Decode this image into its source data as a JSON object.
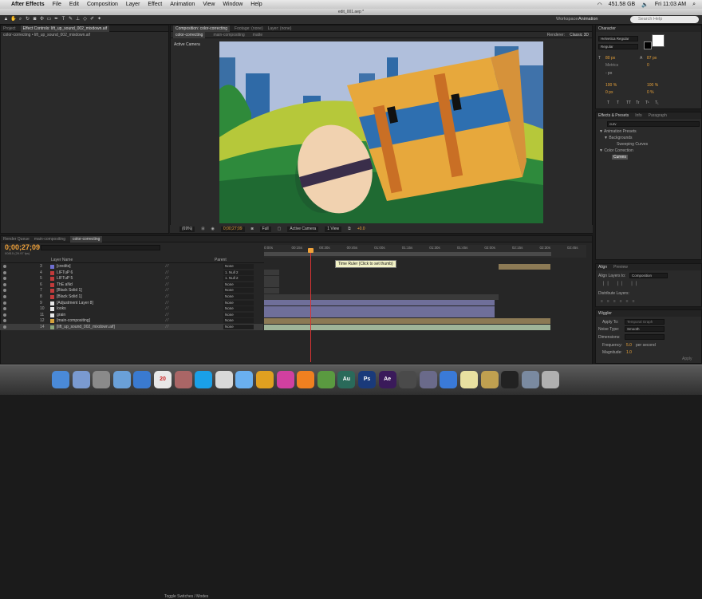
{
  "menubar": {
    "app_name": "After Effects",
    "items": [
      "File",
      "Edit",
      "Composition",
      "Layer",
      "Effect",
      "Animation",
      "View",
      "Window",
      "Help"
    ],
    "battery": "451.58 GB",
    "clock": "Fri 11:03 AM"
  },
  "window_title": "edit_001.aep *",
  "toolbar": {
    "workspace_label": "Workspace:",
    "workspace_value": "Animation",
    "search_placeholder": "Search Help"
  },
  "project_panel": {
    "tabs": [
      "Project",
      "Effect Controls: lift_up_sound_002_mixdown.aif"
    ],
    "subtitle": "color-correcting • lift_up_sound_002_mixdown.aif"
  },
  "comp_panel": {
    "tabs": [
      "Composition: color-correcting",
      "Footage: (none)",
      "Layer: (none)"
    ],
    "breadcrumbs": [
      "color-correcting",
      "main-compositing",
      "matte"
    ],
    "renderer_label": "Renderer:",
    "renderer_value": "Classic 3D",
    "active_camera": "Active Camera"
  },
  "viewer_bar": {
    "zoom": "(69%)",
    "timecode": "0;00;27;09",
    "resolution": "Full",
    "camera": "Active Camera",
    "view": "1 View",
    "exposure": "+0.0"
  },
  "timeline": {
    "tabs": [
      "Render Queue",
      "main-compositing",
      "color-correcting"
    ],
    "current_time": "0;00;27;09",
    "current_frames": "00815 (29.97 fps)",
    "search_placeholder": "",
    "col_layer_name": "Layer Name",
    "col_parent": "Parent",
    "ruler_ticks": [
      "0:00s",
      "00:15s",
      "00:30s",
      "00:45s",
      "01:00s",
      "01:15s",
      "01:30s",
      "01:45s",
      "02:00s",
      "02:15s",
      "02:30s",
      "02:45s"
    ],
    "tooltip": "Time Ruler (Click to set thumb)",
    "toggle_label": "Toggle Switches / Modes",
    "layers": [
      {
        "num": "3",
        "name": "[credits]",
        "parent": "None",
        "color": "#6f6fd1"
      },
      {
        "num": "4",
        "name": "LIFTuP 6",
        "parent": "1. Null 2",
        "color": "#c23b3b"
      },
      {
        "num": "5",
        "name": "LIFTuP 5",
        "parent": "1. Null 2",
        "color": "#c23b3b"
      },
      {
        "num": "6",
        "name": "ThE aNd",
        "parent": "None",
        "color": "#c23b3b"
      },
      {
        "num": "7",
        "name": "[Black Solid 1]",
        "parent": "None",
        "color": "#c23b3b"
      },
      {
        "num": "8",
        "name": "[Black Solid 1]",
        "parent": "None",
        "color": "#c23b3b"
      },
      {
        "num": "9",
        "name": "[Adjustment Layer 8]",
        "parent": "None",
        "color": "#e8e8e8"
      },
      {
        "num": "10",
        "name": "looks",
        "parent": "None",
        "color": "#e8e8e8"
      },
      {
        "num": "11",
        "name": "grain",
        "parent": "None",
        "color": "#e8e8e8"
      },
      {
        "num": "12",
        "name": "[main-compositing]",
        "parent": "None",
        "color": "#d6a33c"
      },
      {
        "num": "14",
        "name": "[lift_up_sound_002_mixdown.aif]",
        "parent": "None",
        "color": "#8aa57a"
      }
    ]
  },
  "character_panel": {
    "title": "Character",
    "font": "Helvetica Regular",
    "style": "Regular",
    "size": "80 px",
    "leading": "87 px",
    "tracking": "Metrics",
    "kerning": "0",
    "stroke": "- px",
    "vscale": "100 %",
    "hscale": "100 %",
    "baseline": "0 px",
    "tsume": "0 %",
    "styles": [
      "T",
      "T",
      "TT",
      "Tr",
      "T¹",
      "T₁"
    ]
  },
  "effects_panel": {
    "tabs": [
      "Effects & Presets",
      "Info",
      "Paragraph"
    ],
    "search_value": "curv",
    "tree": [
      "▼ Animation Presets",
      "▼ Backgrounds",
      "Sweeping Curves",
      "▼ Color Correction",
      "Curves"
    ]
  },
  "align_panel": {
    "tabs": [
      "Align",
      "Preview"
    ],
    "align_label": "Align Layers to:",
    "align_value": "Composition",
    "distribute_label": "Distribute Layers:"
  },
  "wiggler_panel": {
    "title": "Wiggler",
    "apply_to_label": "Apply To:",
    "apply_to_value": "Temporal Graph",
    "noise_label": "Noise Type:",
    "noise_value": "Smooth",
    "dimensions_label": "Dimensions:",
    "frequency_label": "Frequency:",
    "frequency_value": "5.0",
    "frequency_unit": "per second",
    "magnitude_label": "Magnitude:",
    "magnitude_value": "1.0",
    "apply_button": "Apply"
  },
  "colors": {
    "accent_orange": "#f0a23a",
    "cti_red": "#dd3333",
    "panel_bg": "#2a2a2a"
  },
  "dock": {
    "items": [
      "finder",
      "launchpad",
      "system-prefs",
      "mail",
      "safari",
      "calendar",
      "address-book",
      "skype",
      "preview",
      "messages",
      "chrome",
      "itunes",
      "vlc",
      "evernote",
      "Au",
      "Ps",
      "Ae",
      "airdrop",
      "imovie",
      "quicktime",
      "stickies",
      "photo",
      "terminal",
      "downloads",
      "trash"
    ],
    "calendar_day": "20",
    "labels": {
      "au": "Au",
      "ps": "Ps",
      "ae": "Ae"
    }
  }
}
